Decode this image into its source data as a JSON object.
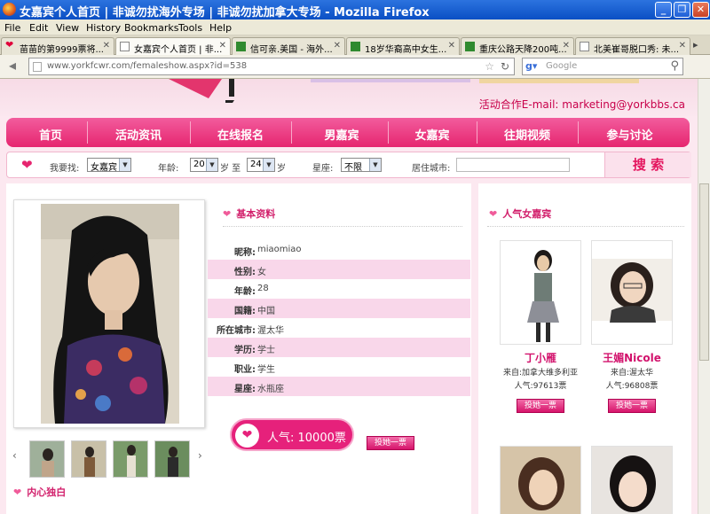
{
  "window": {
    "title": "女嘉宾个人首页 | 非诚勿扰海外专场 | 非诚勿扰加拿大专场 - Mozilla Firefox"
  },
  "menu": [
    "File",
    "Edit",
    "View",
    "History",
    "Bookmarks",
    "Tools",
    "Help"
  ],
  "tabs": [
    {
      "label": "苗苗的第9999票将..."
    },
    {
      "label": "女嘉宾个人首页 | 非..."
    },
    {
      "label": "信可亲.美国 - 海外..."
    },
    {
      "label": "18岁华裔高中女生..."
    },
    {
      "label": "重庆公路天降200吨..."
    },
    {
      "label": "北美崔哥脱口秀: 未..."
    }
  ],
  "nav": {
    "url": "www.yorkfcwr.com/femaleshow.aspx?id=538",
    "search_placeholder": "Google"
  },
  "site": {
    "contact": "活动合作E-mail: marketing@yorkbbs.ca",
    "main_nav": [
      "首页",
      "活动资讯",
      "在线报名",
      "男嘉宾",
      "女嘉宾",
      "往期视频",
      "参与讨论"
    ],
    "search": {
      "find_label": "我要找:",
      "find_value": "女嘉宾",
      "age_label": "年龄:",
      "age_from": "20",
      "age_sep": "岁 至",
      "age_to": "24",
      "age_unit": "岁",
      "sign_label": "星座:",
      "sign_value": "不限",
      "city_label": "居住城市:",
      "button": "搜 索"
    }
  },
  "profile": {
    "section_title": "基本资料",
    "rows": [
      {
        "label": "昵称:",
        "value": "miaomiao"
      },
      {
        "label": "性别:",
        "value": "女"
      },
      {
        "label": "年龄:",
        "value": "28"
      },
      {
        "label": "国籍:",
        "value": "中国"
      },
      {
        "label": "所在城市:",
        "value": "渥太华"
      },
      {
        "label": "学历:",
        "value": "学士"
      },
      {
        "label": "职业:",
        "value": "学生"
      },
      {
        "label": "星座:",
        "value": "水瓶座"
      }
    ],
    "popularity": "人气: 10000票",
    "vote_button": "投她一票",
    "heart_section": "内心独白"
  },
  "hot": {
    "title": "人气女嘉宾",
    "cards": [
      {
        "name": "丁小雁",
        "from": "来自:加拿大维多利亚",
        "votes": "人气:97613票",
        "vote": "投她一票"
      },
      {
        "name": "王媚Nicole",
        "from": "来自:渥太华",
        "votes": "人气:96808票",
        "vote": "投她一票"
      }
    ]
  },
  "colors": {
    "brand_pink": "#e6256f",
    "accent_text": "#d21f6b"
  }
}
